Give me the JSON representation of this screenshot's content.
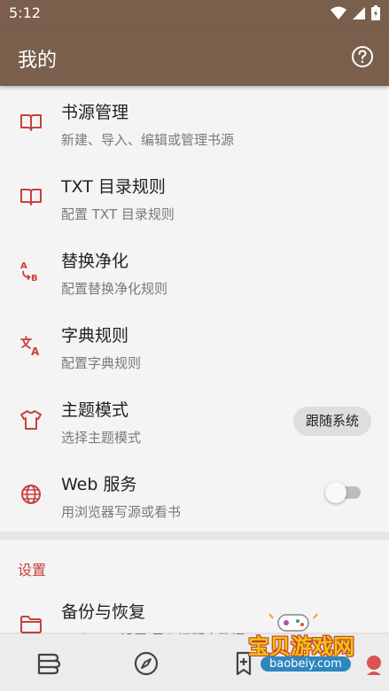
{
  "status": {
    "time": "5:12"
  },
  "appbar": {
    "title": "我的",
    "help_icon": "help-circle-icon"
  },
  "items": [
    {
      "icon": "book-icon",
      "label": "书源管理",
      "sub": "新建、导入、编辑或管理书源"
    },
    {
      "icon": "book-icon",
      "label": "TXT 目录规则",
      "sub": "配置 TXT 目录规则"
    },
    {
      "icon": "replace-icon",
      "label": "替换净化",
      "sub": "配置替换净化规则"
    },
    {
      "icon": "translate-icon",
      "label": "字典规则",
      "sub": "配置字典规则"
    },
    {
      "icon": "shirt-icon",
      "label": "主题模式",
      "sub": "选择主题模式",
      "chip": "跟随系统"
    },
    {
      "icon": "globe-icon",
      "label": "Web 服务",
      "sub": "用浏览器写源或看书",
      "toggle": false
    }
  ],
  "settings": {
    "section_title": "设置",
    "backup": {
      "icon": "folder-icon",
      "label": "备份与恢复",
      "sub": "WebDav 设置/导入旧版本数据"
    }
  },
  "bottom_nav": [
    {
      "icon": "bookshelf-icon"
    },
    {
      "icon": "compass-icon"
    },
    {
      "icon": "bookmark-add-icon"
    }
  ],
  "watermark": {
    "title": "宝贝游戏网",
    "url": "baobeiy.com"
  },
  "colors": {
    "appbar": "#7a5f4c",
    "accent": "#c9403c",
    "background": "#f4f4f4"
  }
}
